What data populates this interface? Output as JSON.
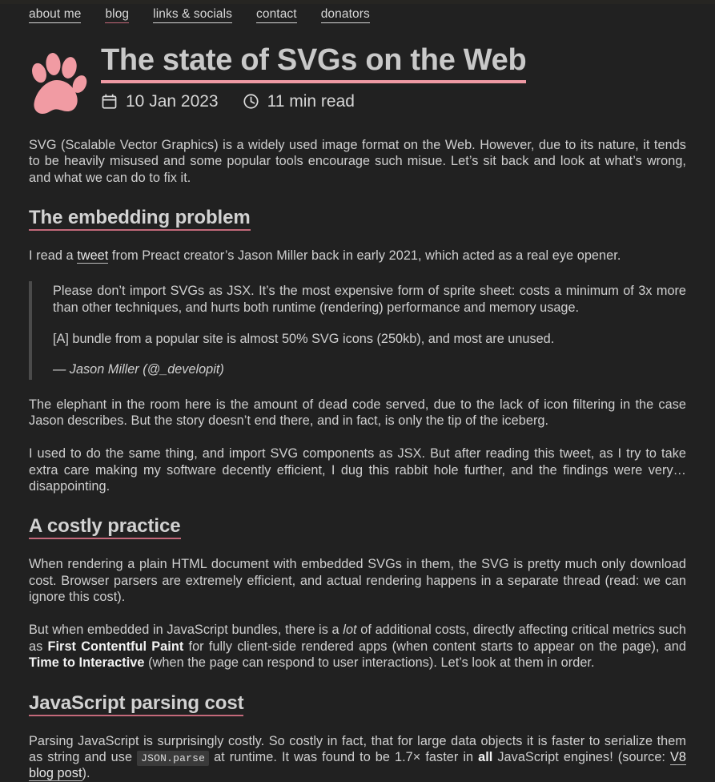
{
  "theme": {
    "background": "#212121",
    "topbar": "#262522",
    "text": "#cfcfcf",
    "accent_pink": "#ef9aa4",
    "accent_rose": "#c4697a",
    "quote_border": "#4b4b4b",
    "code_bg": "#3a3a3a"
  },
  "nav": {
    "items": [
      {
        "label": "about me",
        "active": false
      },
      {
        "label": "blog",
        "active": true
      },
      {
        "label": "links & socials",
        "active": false
      },
      {
        "label": "contact",
        "active": false
      },
      {
        "label": "donators",
        "active": false
      }
    ]
  },
  "article": {
    "logo_icon": "paw-print-icon",
    "title": "The state of SVGs on the Web",
    "meta": {
      "date_icon": "calendar-icon",
      "date": "10 Jan 2023",
      "read_icon": "clock-icon",
      "read_time": "11 min read"
    },
    "intro": "SVG (Scalable Vector Graphics) is a widely used image format on the Web. However, due to its nature, it tends to be heavily misused and some popular tools encourage such misue. Let’s sit back and look at what’s wrong, and what we can do to fix it.",
    "sections": [
      {
        "heading": "The embedding problem",
        "lead_before": "I read a ",
        "lead_link": "tweet",
        "lead_after": " from Preact creator’s Jason Miller back in early 2021, which acted as a real eye opener.",
        "quote": {
          "paragraph1": "Please don’t import SVGs as JSX. It’s the most expensive form of sprite sheet: costs a minimum of 3x more than other techniques, and hurts both runtime (rendering) performance and memory usage.",
          "paragraph2": "[A] bundle from a popular site is almost 50% SVG icons (250kb), and most are unused.",
          "attribution": "— Jason Miller (@_developit)"
        },
        "paragraph_after_1": "The elephant in the room here is the amount of dead code served, due to the lack of icon filtering in the case Jason describes. But the story doesn’t end there, and in fact, is only the tip of the iceberg.",
        "paragraph_after_2": "I used to do the same thing, and import SVG components as JSX. But after reading this tweet, as I try to take extra care making my software decently efficient, I dug this rabbit hole further, and the findings were very… disappointing."
      },
      {
        "heading": "A costly practice",
        "paragraph1": "When rendering a plain HTML document with embedded SVGs in them, the SVG is pretty much only download cost. Browser parsers are extremely efficient, and actual rendering happens in a separate thread (read: we can ignore this cost).",
        "p2_a": "But when embedded in JavaScript bundles, there is a ",
        "p2_em": "lot",
        "p2_b": " of additional costs, directly affecting critical metrics such as ",
        "p2_strong1": "First Contentful Paint",
        "p2_c": " for fully client-side rendered apps (when content starts to appear on the page), and ",
        "p2_strong2": "Time to Interactive",
        "p2_d": " (when the page can respond to user interactions). Let’s look at them in order."
      },
      {
        "heading": "JavaScript parsing cost",
        "p1_a": "Parsing JavaScript is surprisingly costly. So costly in fact, that for large data objects it is faster to serialize them as string and use ",
        "p1_code": "JSON.parse",
        "p1_b": " at runtime. It was found to be 1.7× faster in ",
        "p1_strong": "all",
        "p1_c": " JavaScript engines! (source: ",
        "p1_link": "V8 blog post",
        "p1_d": ")."
      }
    ]
  }
}
